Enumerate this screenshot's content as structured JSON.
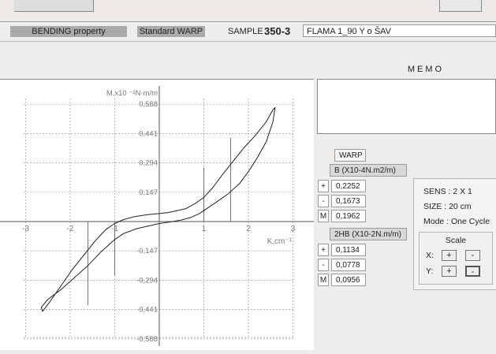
{
  "infobar": {
    "property": "BENDING property",
    "standard": "Standard WARP",
    "sample_label": "SAMPLE",
    "sample_value": "350-3",
    "sample_desc": "FLAMA 1_90 Y o ŠAV"
  },
  "memo": {
    "label": "MEMO",
    "text": ""
  },
  "table": {
    "title": "WARP",
    "b_header": "B (X10-4N.m2/m)",
    "b_rows": [
      {
        "sign": "+",
        "value": "0,2252"
      },
      {
        "sign": "-",
        "value": "0,1673"
      },
      {
        "sign": "M",
        "value": "0,1962"
      }
    ],
    "hb_header": "2HB (X10-2N.m/m)",
    "hb_rows": [
      {
        "sign": "+",
        "value": "0,1134"
      },
      {
        "sign": "-",
        "value": "0,0778"
      },
      {
        "sign": "M",
        "value": "0,0956"
      }
    ]
  },
  "settings": {
    "sens": "SENS : 2 X 1",
    "size": "SIZE  : 20 cm",
    "mode": "Mode  : One Cycle",
    "scale_label": "Scale",
    "x_label": "X:",
    "y_label": "Y:",
    "plus": "+",
    "minus": "-"
  },
  "chart_data": {
    "type": "line",
    "title": "",
    "ylabel": "M,x10 ⁻²N·m/m",
    "xlabel": "K,cm⁻¹",
    "xlim": [
      -3,
      3
    ],
    "ylim": [
      -0.588,
      0.588
    ],
    "xticks": [
      "-3",
      "-2",
      "-1",
      "1",
      "2",
      "3"
    ],
    "xtick_values": [
      -3,
      -2,
      -1,
      1,
      2,
      3
    ],
    "yticks": [
      "0,588",
      "0,441",
      "0,294",
      "0,147",
      "-0,147",
      "-0,294",
      "-0,441",
      "-0,588"
    ],
    "ytick_values": [
      0.588,
      0.441,
      0.294,
      0.147,
      -0.147,
      -0.294,
      -0.441,
      -0.588
    ],
    "grid": true,
    "series": [
      {
        "kind": "hysteresis-loop",
        "x": [
          2.6,
          2.55,
          2.4,
          2.2,
          2.0,
          1.8,
          1.55,
          1.3,
          1.1,
          0.9,
          0.7,
          0.5,
          0.25,
          0.0,
          -0.2,
          -0.5,
          -0.8,
          -1.0,
          -1.3,
          -1.6,
          -1.9,
          -2.2,
          -2.5,
          -2.65,
          -2.62,
          -2.45,
          -2.2,
          -1.95,
          -1.7,
          -1.45,
          -1.2,
          -1.0,
          -0.8,
          -0.55,
          -0.25,
          0.0,
          0.2,
          0.4,
          0.6,
          0.8,
          1.0,
          1.2,
          1.4,
          1.65,
          1.9,
          2.15,
          2.4,
          2.55,
          2.6
        ],
        "y": [
          0.572,
          0.5,
          0.4,
          0.32,
          0.25,
          0.19,
          0.14,
          0.1,
          0.07,
          0.04,
          0.02,
          0.008,
          -0.002,
          -0.01,
          -0.02,
          -0.035,
          -0.06,
          -0.09,
          -0.15,
          -0.22,
          -0.28,
          -0.34,
          -0.39,
          -0.43,
          -0.45,
          -0.4,
          -0.32,
          -0.24,
          -0.17,
          -0.1,
          -0.04,
          -0.01,
          0.01,
          0.025,
          0.035,
          0.04,
          0.045,
          0.055,
          0.065,
          0.09,
          0.12,
          0.17,
          0.23,
          0.3,
          0.37,
          0.43,
          0.5,
          0.56,
          0.572
        ]
      }
    ],
    "marker_lines": [
      {
        "x": -1.6,
        "y_from": -0.42,
        "y_to": 0.0
      },
      {
        "x": -1.0,
        "y_from": -0.27,
        "y_to": 0.0
      },
      {
        "x": 1.0,
        "y_from": 0.0,
        "y_to": 0.27
      },
      {
        "x": 1.6,
        "y_from": 0.0,
        "y_to": 0.42
      }
    ]
  }
}
